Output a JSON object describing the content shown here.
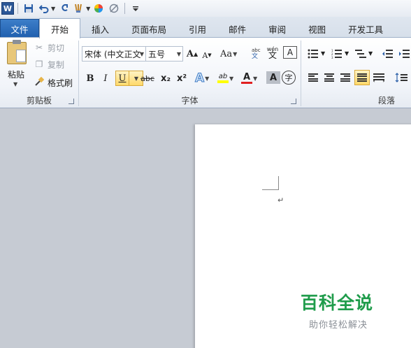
{
  "app": {
    "logo_letter": "W"
  },
  "quick_access": {
    "icons": [
      "save-icon",
      "undo-icon",
      "redo-icon",
      "format-painter-icon",
      "color-icon",
      "clear-format-icon",
      "customize-icon"
    ]
  },
  "tabs": [
    {
      "label": "文件",
      "active": false,
      "kind": "file"
    },
    {
      "label": "开始",
      "active": true
    },
    {
      "label": "插入",
      "active": false
    },
    {
      "label": "页面布局",
      "active": false
    },
    {
      "label": "引用",
      "active": false
    },
    {
      "label": "邮件",
      "active": false
    },
    {
      "label": "审阅",
      "active": false
    },
    {
      "label": "视图",
      "active": false
    },
    {
      "label": "开发工具",
      "active": false
    }
  ],
  "clipboard": {
    "paste_label": "粘贴",
    "cut_label": "剪切",
    "copy_label": "复制",
    "format_painter_label": "格式刷",
    "group_label": "剪贴板"
  },
  "font": {
    "font_name": "宋体 (中文正文",
    "font_size": "五号",
    "grow_label": "A",
    "shrink_label": "A",
    "case_label": "Aa",
    "bold_label": "B",
    "italic_label": "I",
    "underline_label": "U",
    "strike_label": "abc",
    "subscript_label": "x₂",
    "superscript_label": "x²",
    "highlight_label": "ab",
    "font_color_label": "A",
    "char_shading_label": "A",
    "enclose_label": "字",
    "pinyin_label": "wén",
    "pinyin_char": "文",
    "group_label": "字体",
    "highlight_color": "#ffff00",
    "font_color": "#e02020"
  },
  "paragraph": {
    "group_label": "段落"
  },
  "document": {
    "paragraph_mark": "↵"
  },
  "watermark": {
    "title": "百科全说",
    "subtitle": "助你轻松解决"
  }
}
